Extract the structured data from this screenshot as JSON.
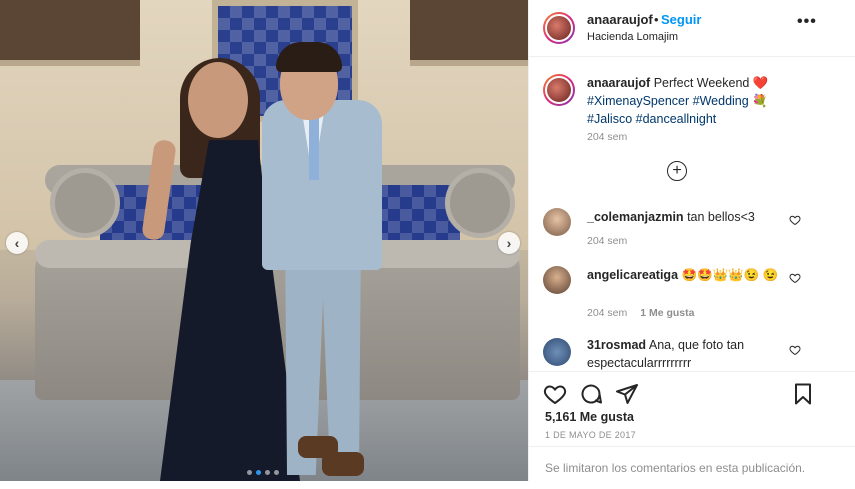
{
  "post": {
    "image_alt": "Couple posing in front of a tiled stone fountain",
    "carousel_dots": 4,
    "carousel_active": 2
  },
  "header": {
    "username": "anaaraujof",
    "separator": "•",
    "follow_label": "Seguir",
    "location": "Hacienda Lomajim",
    "more_label": "•••"
  },
  "caption": {
    "username": "anaaraujof",
    "text": "Perfect Weekend",
    "emoji_heart": "❤️",
    "tags": [
      "#XimenaySpencer",
      "#Wedding",
      "#Jalisco",
      "#danceallnight"
    ],
    "emoji_bouquet": "💐",
    "time": "204 sem"
  },
  "load_more_label": "+",
  "comments": [
    {
      "username": "_colemanjazmin",
      "text": "tan bellos<3",
      "time": "204 sem",
      "likes": ""
    },
    {
      "username": "angelicareatiga",
      "text": "🤩🤩👑👑😉 😉",
      "time": "204 sem",
      "likes": "1 Me gusta"
    },
    {
      "username": "31rosmad",
      "text": "Ana, que foto tan espectacularrrrrrrrr",
      "time": "",
      "likes": ""
    }
  ],
  "actions": {
    "likes": "5,161 Me gusta",
    "date": "1 DE MAYO DE 2017",
    "comments_closed": "Se limitaron los comentarios en esta publicación."
  },
  "colors": {
    "link": "#0095f6",
    "hashtag": "#00376b",
    "muted": "#8e8e8e",
    "heart": "#ed4956"
  }
}
